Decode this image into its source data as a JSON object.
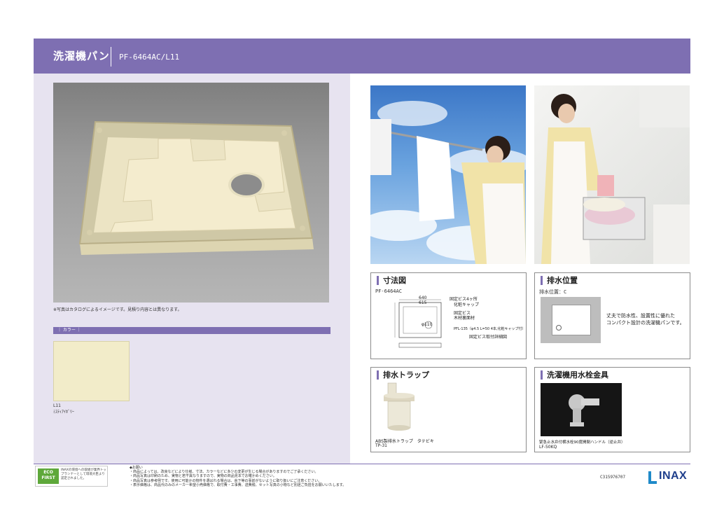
{
  "header": {
    "title": "洗濯機パン",
    "model": "PF-6464AC/L11"
  },
  "main_photo": {
    "note": "※写真はカタログによるイメージです。見積り内容とは異なります。"
  },
  "color_section": {
    "label": "｜ カラー ｜",
    "swatch_code": "L11",
    "swatch_name": "ﾐｽﾃｨｱｲﾎﾞﾘｰ",
    "swatch_color": "#f2ecc9"
  },
  "dimensions": {
    "title": "寸法図",
    "model": "PF-6464AC",
    "labels": [
      "固定ビス4ヶ所",
      "化粧キャップ",
      "固定ビス",
      "木材裏面材",
      "640",
      "615",
      "φ110",
      "PFL-135（φ4.5 L=50 4本,化粧キャップ付）",
      "固定ビス取付詳細図"
    ]
  },
  "drain_position": {
    "title": "排水位置",
    "label": "排水位置：C",
    "description_line1": "丈夫で防水性、設置性に優れた",
    "description_line2": "コンパクト設計の洗濯機パンです。"
  },
  "drain_trap": {
    "title": "排水トラップ",
    "caption": "ABS製排水トラップ　タテビキ",
    "model": "TP-31"
  },
  "faucet": {
    "title": "洗濯機用水栓金具",
    "caption": "緊急止水弁付横水栓90度開閉ハンドル（逆止弁）",
    "model": "LF-50KQ"
  },
  "footer": {
    "eco_logo_top": "ECO",
    "eco_logo_bottom": "FIRST",
    "eco_text": "INAXの環境への取組が業界トップランナーとして環境大臣より認定されました。",
    "notes": [
      "◆お願い",
      "・商品によっては、改良などにより仕様、寸法、カラーなどに多少の変更が生じる場合がありますのでご了承ください。",
      "・商品写真は印刷のため、実物と若干異なりますので、実物の商品見本でお確かめください。",
      "・商品写真は参考例です。使用に可能かの物件を選ばれる場合は、余下等の事前がないように取り扱いにご注意ください。",
      "・表示価格は、商品代のみのメーカー希望小売価格で、取付費・工事費、送費税、セット写真の小物など別途ご負担をお願いいたします。"
    ],
    "doc_code": "C315976707",
    "brand": "INAX"
  }
}
